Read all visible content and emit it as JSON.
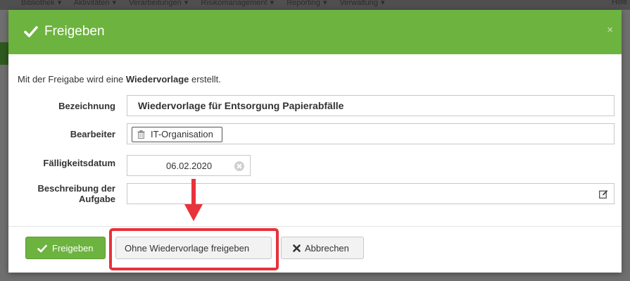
{
  "background": {
    "menu": [
      "Bibliothek ▾",
      "Aktivitäten ▾",
      "Verarbeitungen ▾",
      "Risikomanagement ▾",
      "Reporting ▾",
      "Verwaltung ▾"
    ],
    "right_text": "Hilfe"
  },
  "modal": {
    "title": "Freigeben",
    "close": "×",
    "info_prefix": "Mit der Freigabe wird eine ",
    "info_bold": "Wiedervorlage",
    "info_suffix": " erstellt.",
    "fields": {
      "bezeichnung": {
        "label": "Bezeichnung",
        "value": "Wiedervorlage für Entsorgung Papierabfälle"
      },
      "bearbeiter": {
        "label": "Bearbeiter",
        "value": "IT-Organisation"
      },
      "faelligkeitsdatum": {
        "label": "Fälligkeitsdatum",
        "value": "06.02.2020"
      },
      "beschreibung": {
        "label_line1": "Beschreibung der",
        "label_line2": "Aufgabe",
        "value": ""
      }
    },
    "buttons": {
      "freigeben": "Freigeben",
      "ohne_wiedervorlage": "Ohne Wiedervorlage freigeben",
      "abbrechen": "Abbrechen"
    }
  },
  "colors": {
    "header_green": "#6db33f",
    "highlight_red": "#e8323c"
  }
}
